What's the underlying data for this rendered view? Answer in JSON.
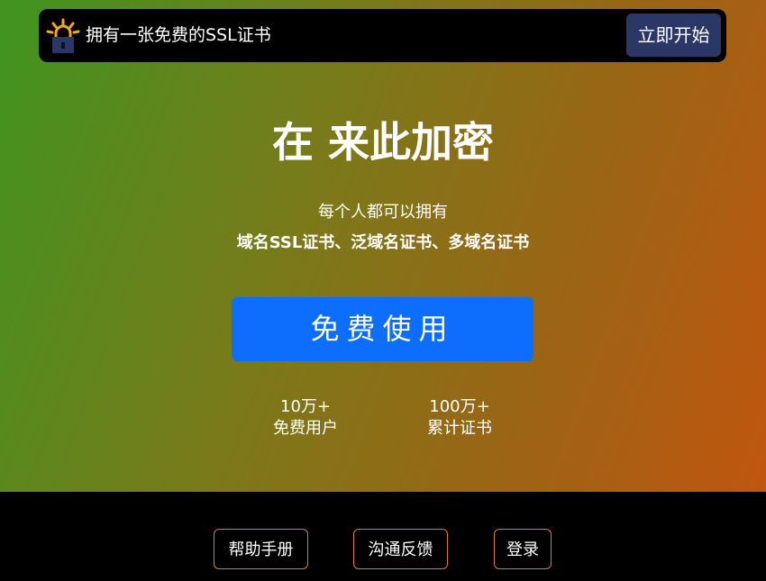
{
  "topbar": {
    "logo_icon": "padlock-sun-icon",
    "title": "拥有一张免费的SSL证书",
    "start_button": "立即开始"
  },
  "hero": {
    "title": "在 来此加密",
    "subtitle": "每个人都可以拥有",
    "subtitle_bold": "域名SSL证书、泛域名证书、多域名证书",
    "cta_button": "免费使用",
    "stats": [
      {
        "value": "10万+",
        "label": "免费用户"
      },
      {
        "value": "100万+",
        "label": "累计证书"
      }
    ]
  },
  "footer": {
    "help": "帮助手册",
    "feedback": "沟通反馈",
    "login": "登录"
  },
  "colors": {
    "cta": "#0d6efd",
    "start_button": "#2b3766",
    "footer_border": "#e0793a"
  }
}
